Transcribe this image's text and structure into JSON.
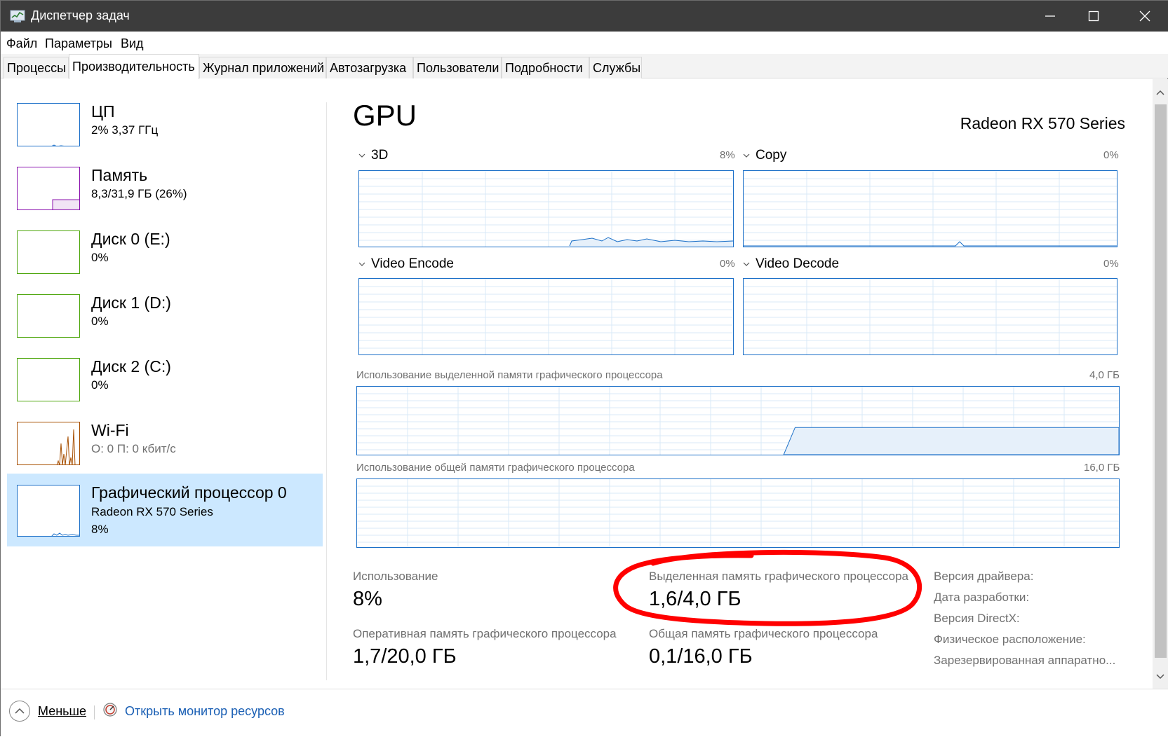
{
  "window": {
    "title": "Диспетчер задач"
  },
  "menu": [
    "Файл",
    "Параметры",
    "Вид"
  ],
  "tabs": [
    "Процессы",
    "Производительность",
    "Журнал приложений",
    "Автозагрузка",
    "Пользователи",
    "Подробности",
    "Службы"
  ],
  "active_tab": 1,
  "sidebar": {
    "items": [
      {
        "name": "ЦП",
        "sub": "2%  3,37 ГГц",
        "sub2": ""
      },
      {
        "name": "Память",
        "sub": "8,3/31,9 ГБ (26%)",
        "sub2": ""
      },
      {
        "name": "Диск 0 (E:)",
        "sub": "0%",
        "sub2": ""
      },
      {
        "name": "Диск 1 (D:)",
        "sub": "0%",
        "sub2": ""
      },
      {
        "name": "Диск 2 (C:)",
        "sub": "0%",
        "sub2": ""
      },
      {
        "name": "Wi-Fi",
        "sub": "О: 0 П: 0 кбит/с",
        "sub2": ""
      },
      {
        "name": "Графический процессор 0",
        "sub": "Radeon RX 570 Series",
        "sub2": "8%"
      }
    ],
    "selected": 6
  },
  "gpu": {
    "title": "GPU",
    "model": "Radeon RX 570 Series",
    "engines": [
      {
        "name": "3D",
        "pct": "8%"
      },
      {
        "name": "Copy",
        "pct": "0%"
      },
      {
        "name": "Video Encode",
        "pct": "0%"
      },
      {
        "name": "Video Decode",
        "pct": "0%"
      }
    ],
    "dedicated_mem_label": "Использование выделенной памяти графического процессора",
    "dedicated_mem_max": "4,0 ГБ",
    "shared_mem_label": "Использование общей памяти графического процессора",
    "shared_mem_max": "16,0 ГБ",
    "dedicated_mem_fraction": 0.4
  },
  "stats": {
    "usage_label": "Использование",
    "usage_value": "8%",
    "dedicated_label": "Выделенная память графического процессора",
    "dedicated_value": "1,6/4,0 ГБ",
    "ram_label": "Оперативная память графического процессора",
    "ram_value": "1,7/20,0 ГБ",
    "shared_label": "Общая память графического процессора",
    "shared_value": "0,1/16,0 ГБ"
  },
  "info": [
    "Версия драйвера:",
    "Дата разработки:",
    "Версия DirectX:",
    "Физическое расположение:",
    "Зарезервированная аппаратно..."
  ],
  "bottom": {
    "less": "Меньше",
    "monitor": "Открыть монитор ресурсов"
  },
  "colors": {
    "cpu": "#1c70c8",
    "memory": "#8b12ae",
    "disk": "#4da60c",
    "wifi": "#a74f01",
    "gpu": "#1c70c8",
    "selected_bg": "#cce8ff",
    "annotation": "#ff0000"
  }
}
